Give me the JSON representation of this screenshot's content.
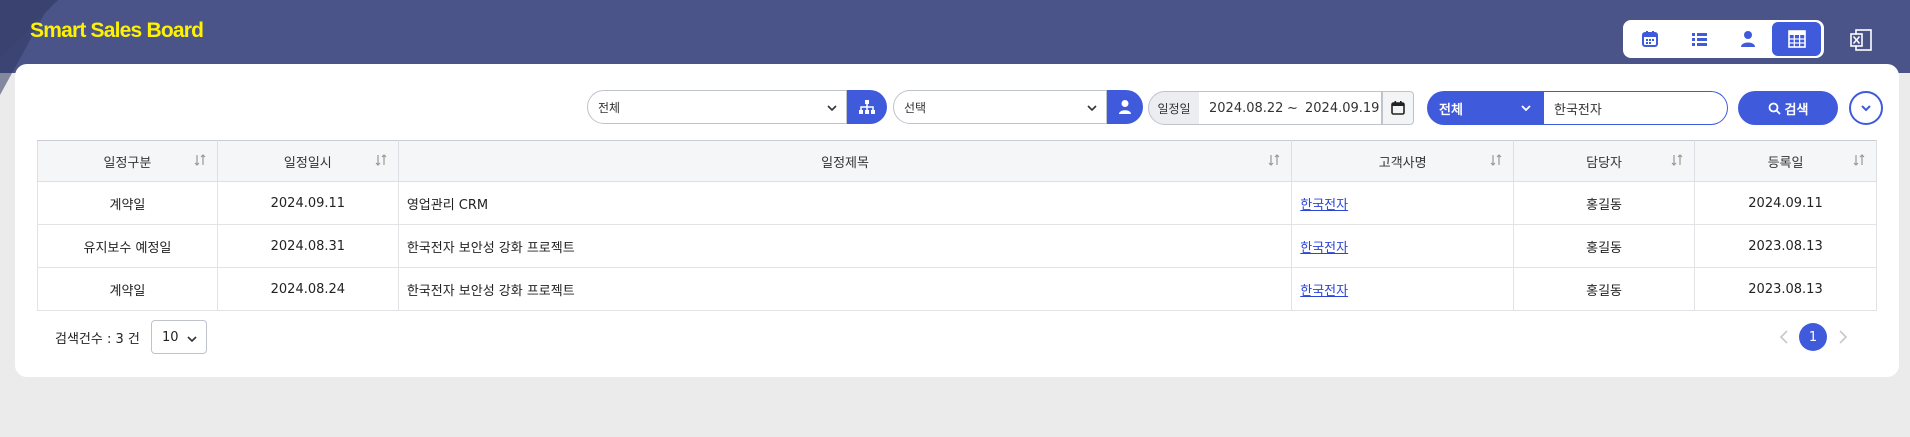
{
  "app": {
    "title": "Smart Sales Board"
  },
  "colors": {
    "header": "#4a5489",
    "accent": "#3f5bdb",
    "title": "#fff200"
  },
  "view_switch": {
    "buttons": [
      {
        "icon": "calendar-icon"
      },
      {
        "icon": "list-icon"
      },
      {
        "icon": "user-icon"
      },
      {
        "icon": "grid-calendar-icon",
        "active": true
      }
    ],
    "excel_icon": "excel-export-icon"
  },
  "filters": {
    "org_select": {
      "value": "전체",
      "icon": "org-chart-icon"
    },
    "person_select": {
      "value": "선택",
      "icon": "user-icon"
    },
    "date_label": "일정일",
    "date_from": "2024.08.22",
    "date_sep": "~",
    "date_to": "2024.09.19",
    "field_select": {
      "value": "전체"
    },
    "keyword": "한국전자",
    "search_label": "검색"
  },
  "table": {
    "columns": [
      "일정구분",
      "일정일시",
      "일정제목",
      "고객사명",
      "담당자",
      "등록일"
    ],
    "rows": [
      [
        "계약일",
        "2024.09.11",
        "영업관리 CRM",
        "한국전자",
        "홍길동",
        "2024.09.11"
      ],
      [
        "유지보수 예정일",
        "2024.08.31",
        "한국전자 보안성 강화 프로젝트",
        "한국전자",
        "홍길동",
        "2023.08.13"
      ],
      [
        "계약일",
        "2024.08.24",
        "한국전자 보안성 강화 프로젝트",
        "한국전자",
        "홍길동",
        "2023.08.13"
      ]
    ]
  },
  "footer": {
    "count_text": "검색건수 : 3 건",
    "page_size": "10",
    "current_page": "1"
  }
}
